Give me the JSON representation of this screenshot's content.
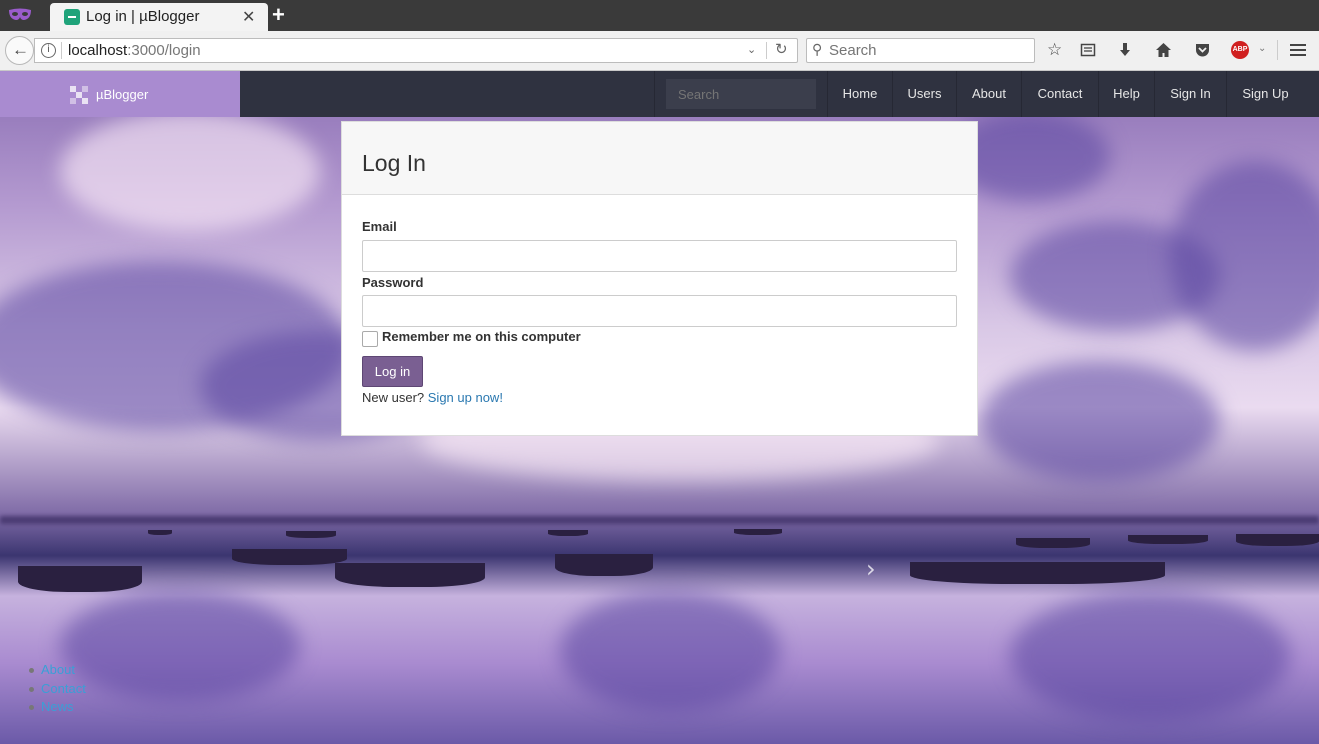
{
  "browser": {
    "tab_title": "Log in | µBlogger",
    "tab_close": "✕",
    "new_tab": "+",
    "url_host": "localhost",
    "url_path": ":3000/login",
    "search_placeholder": "Search",
    "icons": [
      "back-arrow-icon",
      "info-icon",
      "reload-icon",
      "search-icon",
      "bookmark-star-icon",
      "reader-view-icon",
      "download-icon",
      "home-icon",
      "pocket-icon",
      "adblock-icon",
      "hamburger-menu-icon"
    ],
    "adblock_label": "ABP"
  },
  "site": {
    "brand": "µBlogger",
    "brand_color": "#a98bd0",
    "navbar_color": "#2f3240",
    "search_placeholder": "Search",
    "nav": [
      "Home",
      "Users",
      "About",
      "Contact",
      "Help",
      "Sign In",
      "Sign Up"
    ]
  },
  "login": {
    "title": "Log In",
    "email_label": "Email",
    "email_value": "",
    "password_label": "Password",
    "password_value": "",
    "remember_label": "Remember me on this computer",
    "remember_checked": false,
    "submit_label": "Log in",
    "button_color": "#7a5f92",
    "new_user_text": "New user?",
    "signup_link": "Sign up now!"
  },
  "footer": {
    "links": [
      "About",
      "Contact",
      "News"
    ]
  },
  "carousel_next": "›"
}
